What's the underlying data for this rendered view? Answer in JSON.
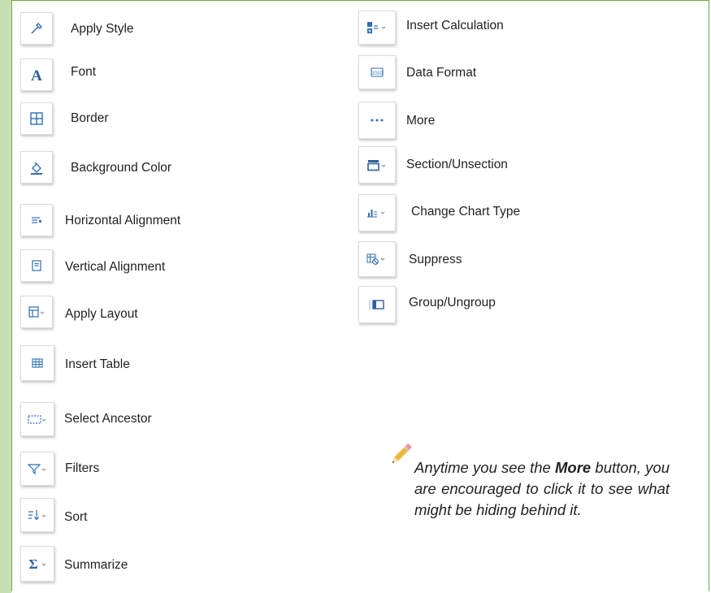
{
  "left_column": [
    {
      "label": "Apply Style",
      "icon": "paint-dropper-icon"
    },
    {
      "label": "Font",
      "icon": "font-a-icon"
    },
    {
      "label": "Border",
      "icon": "border-grid-icon"
    },
    {
      "label": "Background Color",
      "icon": "paint-bucket-icon"
    },
    {
      "label": "Horizontal Alignment",
      "icon": "horizontal-align-icon"
    },
    {
      "label": "Vertical Alignment",
      "icon": "vertical-align-icon"
    },
    {
      "label": "Apply Layout",
      "icon": "layout-icon"
    },
    {
      "label": "Insert Table",
      "icon": "table-icon"
    },
    {
      "label": "Select Ancestor",
      "icon": "select-ancestor-icon"
    },
    {
      "label": "Filters",
      "icon": "filter-icon"
    },
    {
      "label": "Sort",
      "icon": "sort-icon"
    },
    {
      "label": "Summarize",
      "icon": "sigma-icon"
    }
  ],
  "right_column": [
    {
      "label": "Insert Calculation",
      "icon": "calculation-icon"
    },
    {
      "label": "Data Format",
      "icon": "data-format-icon"
    },
    {
      "label": "More",
      "icon": "more-ellipsis-icon"
    },
    {
      "label": "Section/Unsection",
      "icon": "section-icon"
    },
    {
      "label": "Change Chart Type",
      "icon": "chart-type-icon"
    },
    {
      "label": "Suppress",
      "icon": "suppress-icon"
    },
    {
      "label": "Group/Ungroup",
      "icon": "group-icon"
    }
  ],
  "note": {
    "before": "Anytime you see the ",
    "bold": "More",
    "after": " button, you are encouraged to click it to see what might be hiding behind it."
  },
  "colors": {
    "frame_border": "#70ad47",
    "left_band": "#c6e0b4",
    "icon_blue": "#2f6fb0"
  }
}
